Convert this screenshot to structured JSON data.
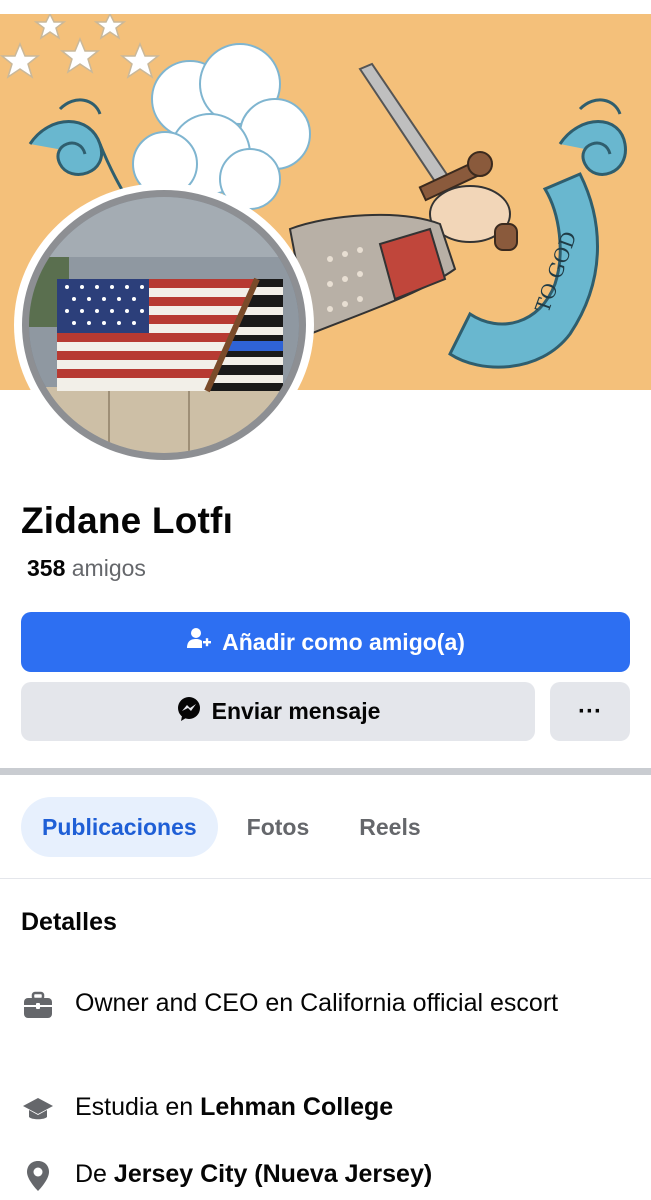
{
  "profile": {
    "name": "Zidane Lotfı",
    "friends_count": "358",
    "friends_label": "amigos"
  },
  "cover": {
    "banner_text": "TO GOD",
    "background": "#f4c07a"
  },
  "actions": {
    "add_friend": "Añadir como amigo(a)",
    "message": "Enviar mensaje",
    "more": "···"
  },
  "tabs": [
    {
      "label": "Publicaciones",
      "active": true
    },
    {
      "label": "Fotos",
      "active": false
    },
    {
      "label": "Reels",
      "active": false
    }
  ],
  "details": {
    "title": "Detalles",
    "work": {
      "icon": "briefcase-icon",
      "text": "Owner and CEO en California official escort"
    },
    "education": {
      "icon": "graduation-cap-icon",
      "prefix": "Estudia en",
      "value": "Lehman College"
    },
    "hometown": {
      "icon": "location-pin-icon",
      "prefix": "De",
      "value": "Jersey City (Nueva Jersey)"
    }
  },
  "colors": {
    "accent": "#2d6ff2",
    "tab_active_bg": "#e7f0fd",
    "tab_active_text": "#1f5fd6",
    "secondary_button": "#e4e6eb"
  }
}
